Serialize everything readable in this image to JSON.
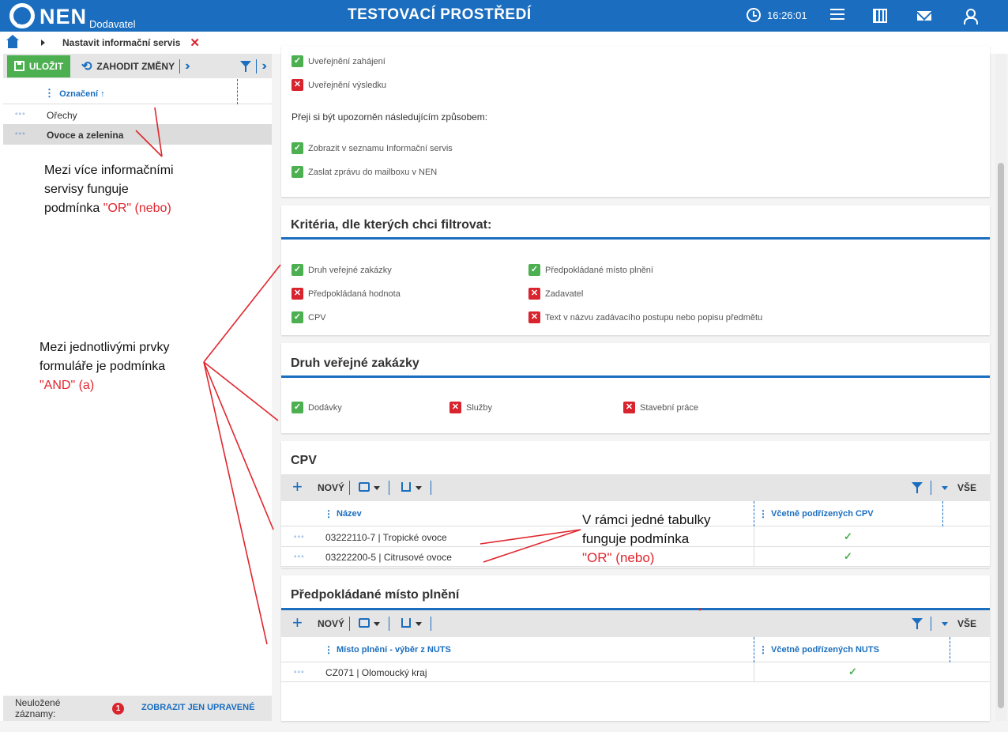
{
  "header": {
    "logo_text": "NEN",
    "logo_sub": "Dodavatel",
    "env_title": "TESTOVACÍ PROSTŘEDÍ",
    "clock": "16:26:01",
    "icons": [
      "clock-icon",
      "menu-icon",
      "calculator-icon",
      "mail-icon",
      "user-icon"
    ]
  },
  "breadcrumb": {
    "label": "Nastavit informační servis",
    "close": "✕"
  },
  "left": {
    "save_label": "ULOŽIT",
    "discard_label": "ZAHODIT ZMĚNY",
    "column_header": "Označení ↑",
    "rows": [
      "Ořechy",
      "Ovoce a zelenina"
    ],
    "selected_row": "Ovoce a zelenina",
    "footer_label": "Neuložené záznamy:",
    "footer_count": "1",
    "footer_link": "ZOBRAZIT JEN UPRAVENÉ"
  },
  "notes": {
    "n1_a": "Mezi více informačními",
    "n1_b": "servisy funguje",
    "n1_c": "podmínka ",
    "n1_red": "\"OR\" (nebo)",
    "n2_a": "Mezi jednotlivými prvky",
    "n2_b": "formuláře je podmínka",
    "n2_red": "\"AND\" (a)",
    "n3_a": "V rámci jedné tabulky",
    "n3_b": "funguje podmínka",
    "n3_red": "\"OR\" (nebo)"
  },
  "top_card": {
    "publish_start": "Uveřejnění zahájení",
    "publish_start_checked": true,
    "publish_result": "Uveřejnění výsledku",
    "publish_result_checked": false,
    "notify_heading": "Přeji si být upozorněn následujícím způsobem:",
    "notify_list": "Zobrazit v seznamu Informační servis",
    "notify_list_checked": true,
    "notify_mail": "Zaslat zprávu do mailboxu v NEN",
    "notify_mail_checked": true
  },
  "criteria": {
    "title": "Kritéria, dle kterých chci filtrovat:",
    "items": [
      {
        "label": "Druh veřejné zakázky",
        "checked": true
      },
      {
        "label": "Předpokládané místo plnění",
        "checked": true
      },
      {
        "label": "Předpokládaná hodnota",
        "checked": false
      },
      {
        "label": "Zadavatel",
        "checked": false
      },
      {
        "label": "CPV",
        "checked": true
      },
      {
        "label": "Text v názvu zadávacího postupu nebo popisu předmětu",
        "checked": false
      }
    ]
  },
  "contract_type": {
    "title": "Druh veřejné zakázky",
    "items": [
      {
        "label": "Dodávky",
        "checked": true
      },
      {
        "label": "Služby",
        "checked": false
      },
      {
        "label": "Stavební práce",
        "checked": false
      }
    ]
  },
  "cpv": {
    "title": "CPV",
    "new_label": "NOVÝ",
    "all_label": "VŠE",
    "col_name": "Název",
    "col_sub": "Včetně podřízených CPV",
    "rows": [
      {
        "name": "03222110-7 | Tropické ovoce",
        "sub": "✓"
      },
      {
        "name": "03222200-5 | Citrusové ovoce",
        "sub": "✓"
      }
    ]
  },
  "place": {
    "title": "Předpokládané místo plnění",
    "new_label": "NOVÝ",
    "all_label": "VŠE",
    "col_name": "Místo plnění - výběr z NUTS",
    "col_sub": "Včetně podřízených NUTS",
    "rows": [
      {
        "name": "CZ071 | Olomoucký kraj",
        "sub": "✓"
      }
    ]
  },
  "colors": {
    "brand": "#1b6ebf",
    "ok": "#4caf50",
    "error": "#d9232d",
    "annotation": "#e0262e"
  }
}
